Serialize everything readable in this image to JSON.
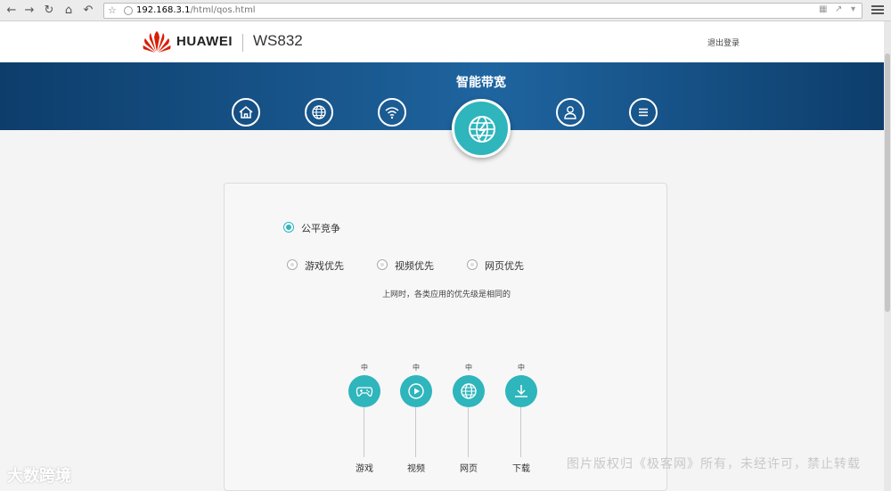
{
  "browser": {
    "url_host": "192.168.3.1",
    "url_path": "/html/qos.html"
  },
  "header": {
    "brand": "HUAWEI",
    "model": "WS832",
    "logout": "退出登录"
  },
  "banner": {
    "title": "智能带宽",
    "nav_icons": [
      "home-icon",
      "globe-icon",
      "wifi-icon",
      "bandwidth-icon",
      "user-icon",
      "menu-icon"
    ],
    "active": "bandwidth-icon"
  },
  "qos": {
    "options": [
      {
        "label": "公平竞争",
        "selected": true
      },
      {
        "label": "游戏优先",
        "selected": false
      },
      {
        "label": "视频优先",
        "selected": false
      },
      {
        "label": "网页优先",
        "selected": false
      }
    ],
    "description": "上网时，各类应用的优先级是相同的",
    "apps": [
      {
        "level": "中",
        "label": "游戏",
        "icon": "gamepad-icon"
      },
      {
        "level": "中",
        "label": "视频",
        "icon": "play-icon"
      },
      {
        "level": "中",
        "label": "网页",
        "icon": "globe-icon"
      },
      {
        "level": "中",
        "label": "下载",
        "icon": "download-icon"
      }
    ]
  },
  "watermarks": {
    "left": "大数跨境",
    "right": "图片版权归《极客网》所有，未经许可，禁止转载"
  },
  "colors": {
    "accent": "#2fb5bc",
    "banner": "#1b5c94"
  }
}
